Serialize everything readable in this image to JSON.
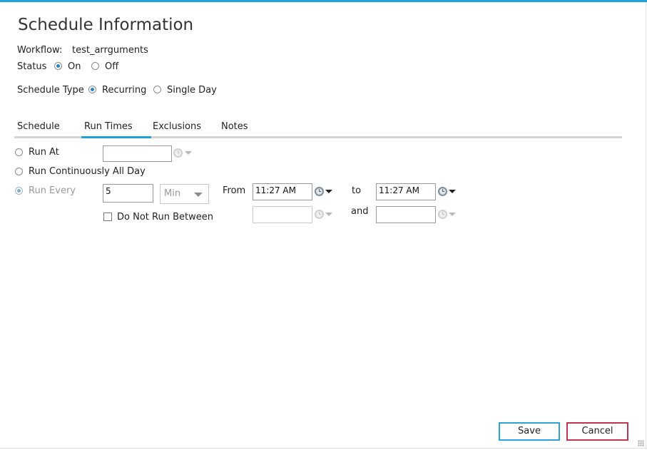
{
  "dialog": {
    "title": "Schedule Information"
  },
  "workflow": {
    "label": "Workflow:",
    "value": "test_arrguments"
  },
  "status": {
    "label": "Status",
    "options": {
      "on": "On",
      "off": "Off"
    },
    "selected": "On"
  },
  "schedule_type": {
    "label": "Schedule Type",
    "options": {
      "recurring": "Recurring",
      "single_day": "Single Day"
    },
    "selected": "Recurring"
  },
  "tabs": [
    {
      "label": "Schedule"
    },
    {
      "label": "Run Times"
    },
    {
      "label": "Exclusions"
    },
    {
      "label": "Notes"
    }
  ],
  "active_tab": "Run Times",
  "run_times": {
    "run_at": {
      "label": "Run At",
      "value": ""
    },
    "run_continuously": {
      "label": "Run Continuously All Day"
    },
    "run_every": {
      "label": "Run Every",
      "interval": "5",
      "unit": "Min",
      "from_label": "From",
      "from_value": "11:27 AM",
      "to_label": "to",
      "to_value": "11:27 AM"
    },
    "do_not_run_between": {
      "label": "Do Not Run Between",
      "checked": false,
      "start_value": "",
      "and_label": "and",
      "end_value": ""
    },
    "selected_option": "Run Every"
  },
  "buttons": {
    "save": "Save",
    "cancel": "Cancel"
  },
  "colors": {
    "accent": "#1ea1d8",
    "cancel_border": "#c2334d",
    "tab_inactive_line": "#d4d4d4"
  },
  "icons": [
    "clock-icon",
    "dropdown-arrow-icon",
    "resize-grip-icon"
  ]
}
